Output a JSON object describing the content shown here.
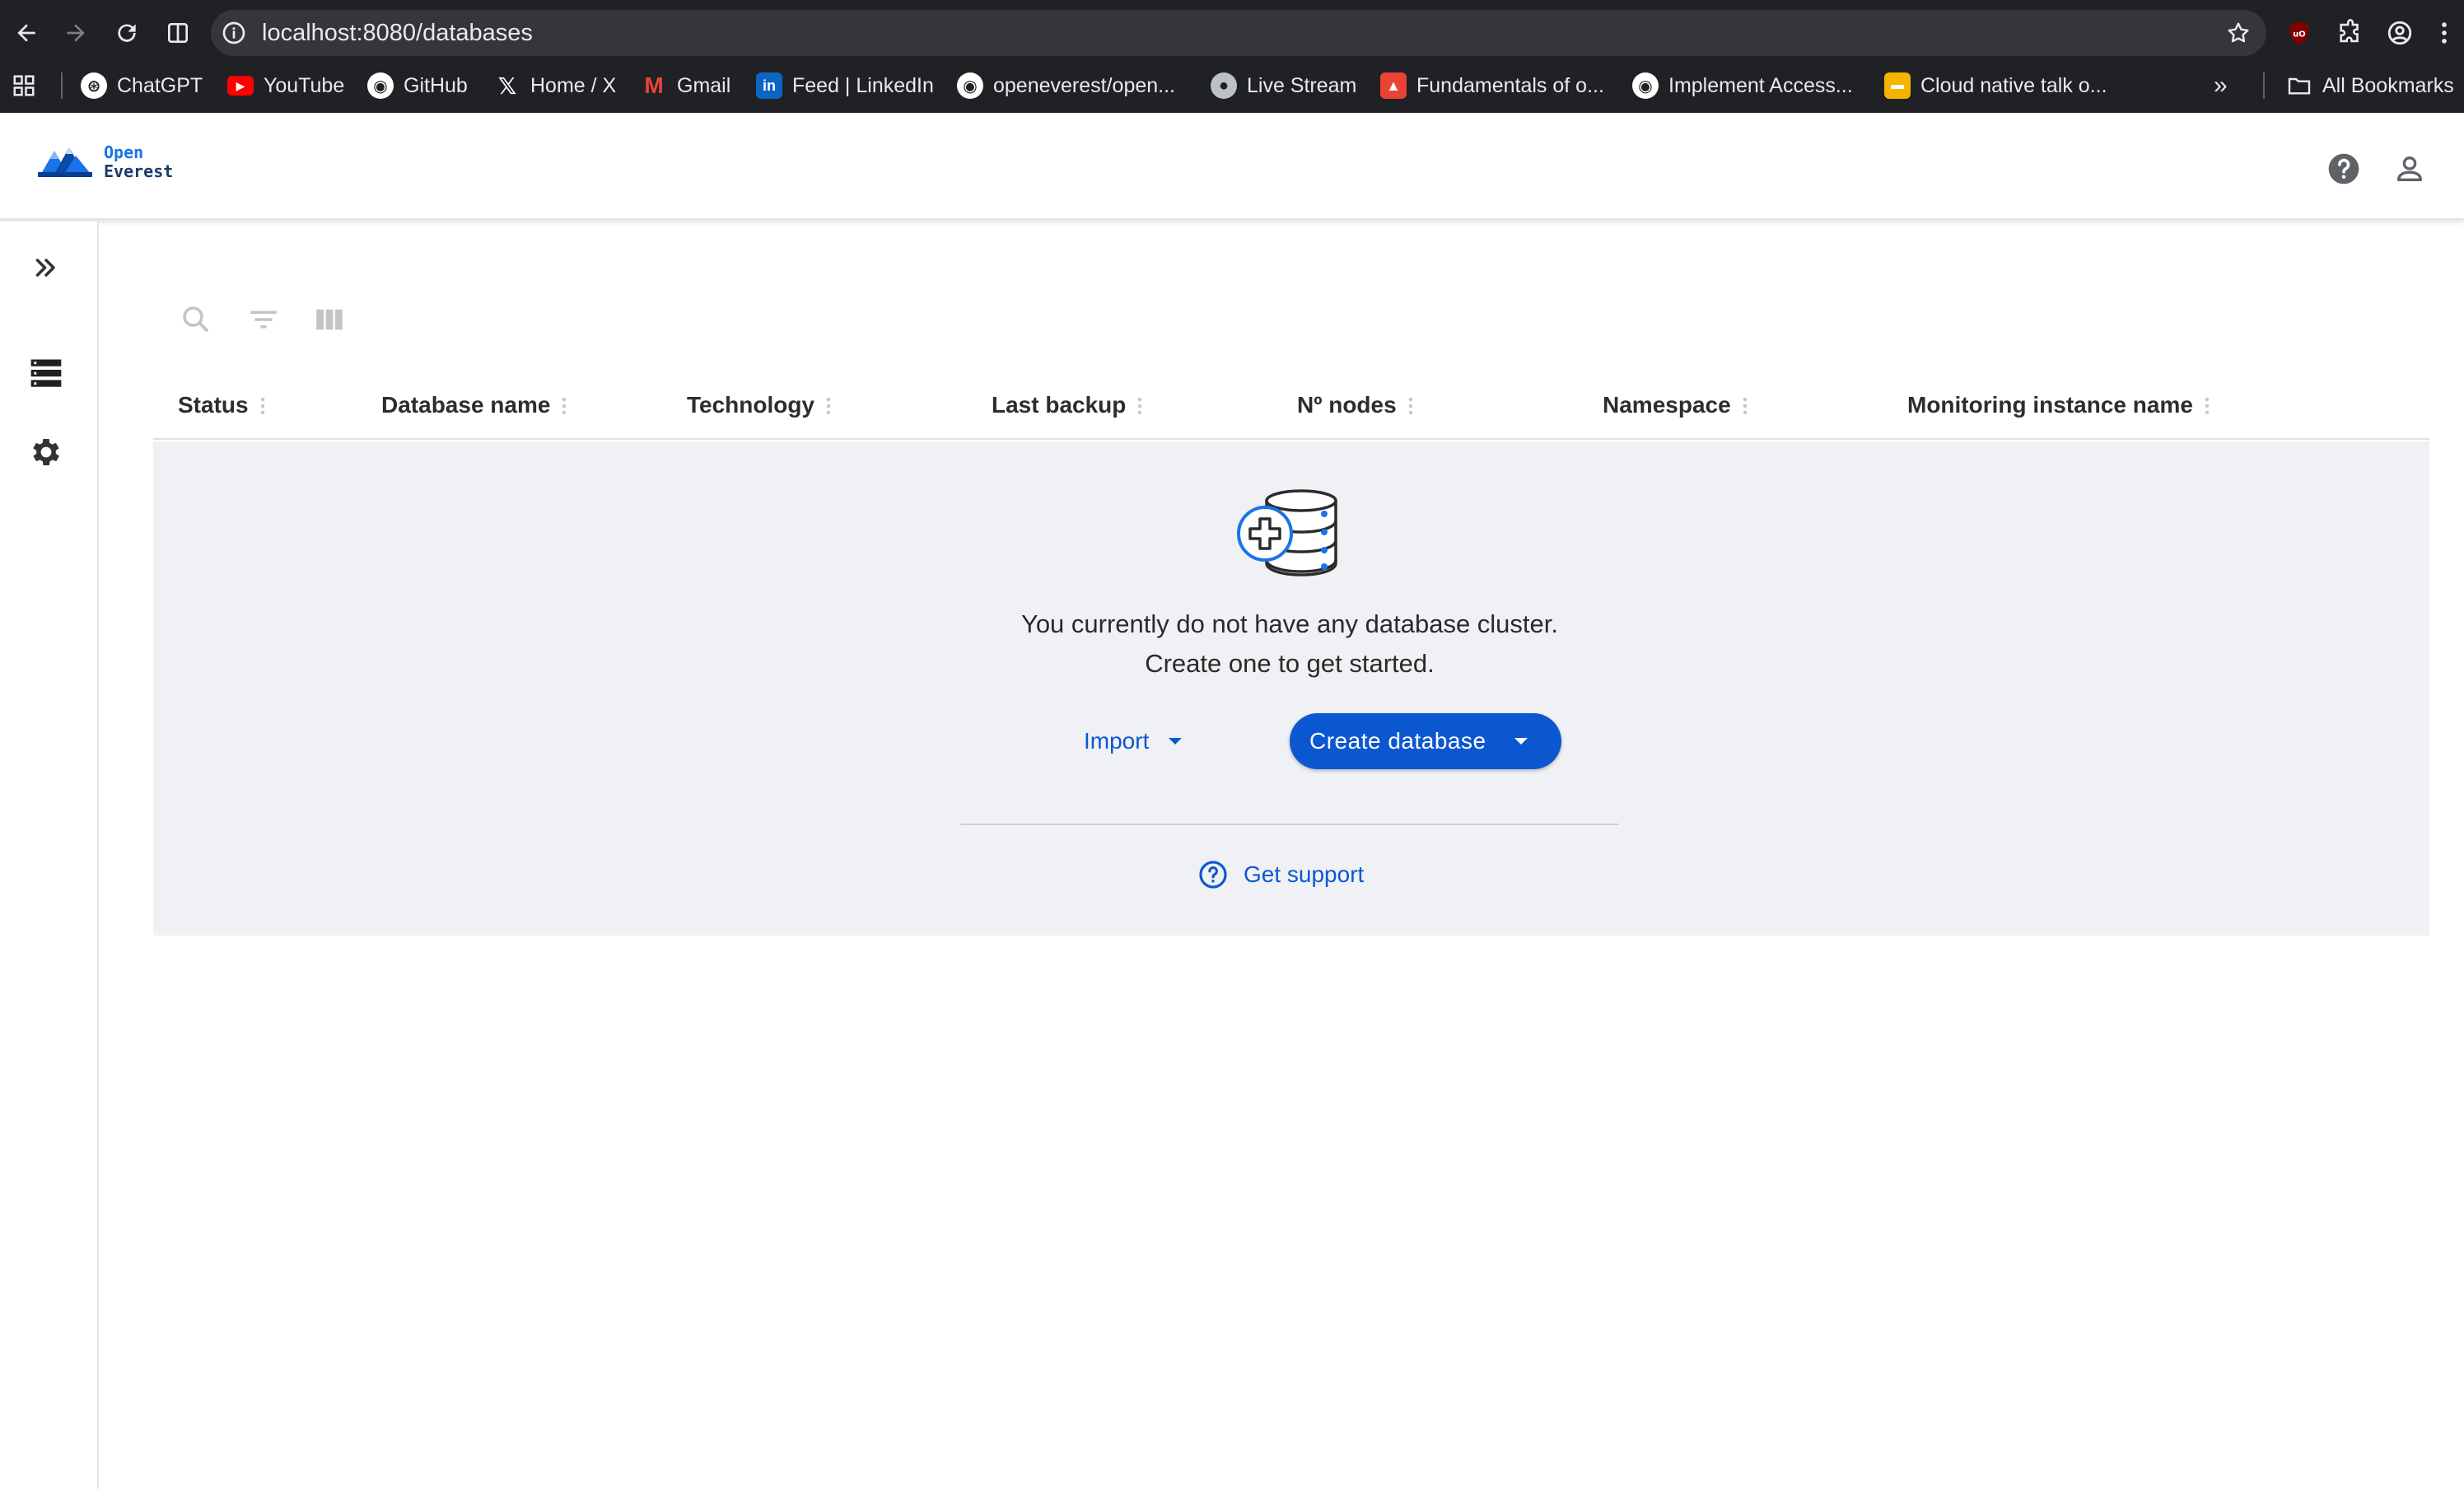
{
  "browser": {
    "url": "localhost:8080/databases",
    "bookmarks": [
      {
        "label": "ChatGPT",
        "icon": "chatgpt-icon",
        "color": "#ffffff"
      },
      {
        "label": "YouTube",
        "icon": "youtube-icon",
        "color": "#ff0000"
      },
      {
        "label": "GitHub",
        "icon": "github-icon",
        "color": "#ffffff"
      },
      {
        "label": "Home / X",
        "icon": "x-icon",
        "color": "#ffffff"
      },
      {
        "label": "Gmail",
        "icon": "gmail-icon",
        "color": "#ea4335"
      },
      {
        "label": "Feed | LinkedIn",
        "icon": "linkedin-icon",
        "color": "#0a66c2"
      },
      {
        "label": "openeverest/open...",
        "icon": "github-icon",
        "color": "#ffffff"
      },
      {
        "label": "Live Stream",
        "icon": "globe-icon",
        "color": "#bdc1c6"
      },
      {
        "label": "Fundamentals of o...",
        "icon": "fire-icon",
        "color": "#ea4335"
      },
      {
        "label": "Implement Access...",
        "icon": "github-icon",
        "color": "#ffffff"
      },
      {
        "label": "Cloud native talk o...",
        "icon": "slides-icon",
        "color": "#f4b400"
      }
    ],
    "all_bookmarks": "All Bookmarks"
  },
  "app": {
    "logo_line1": "Open",
    "logo_line2": "Everest"
  },
  "toolbar": {
    "search": "search-icon",
    "filter": "filter-icon",
    "columns": "columns-icon"
  },
  "table": {
    "columns": [
      "Status",
      "Database name",
      "Technology",
      "Last backup",
      "Nº nodes",
      "Namespace",
      "Monitoring instance name"
    ]
  },
  "empty_state": {
    "line1": "You currently do not have any database cluster.",
    "line2": "Create one to get started.",
    "import_label": "Import",
    "create_label": "Create database",
    "support_label": "Get support"
  },
  "colors": {
    "primary": "#0b57d0",
    "panel_bg": "#f0f1f4",
    "chrome_bg": "#202124"
  }
}
